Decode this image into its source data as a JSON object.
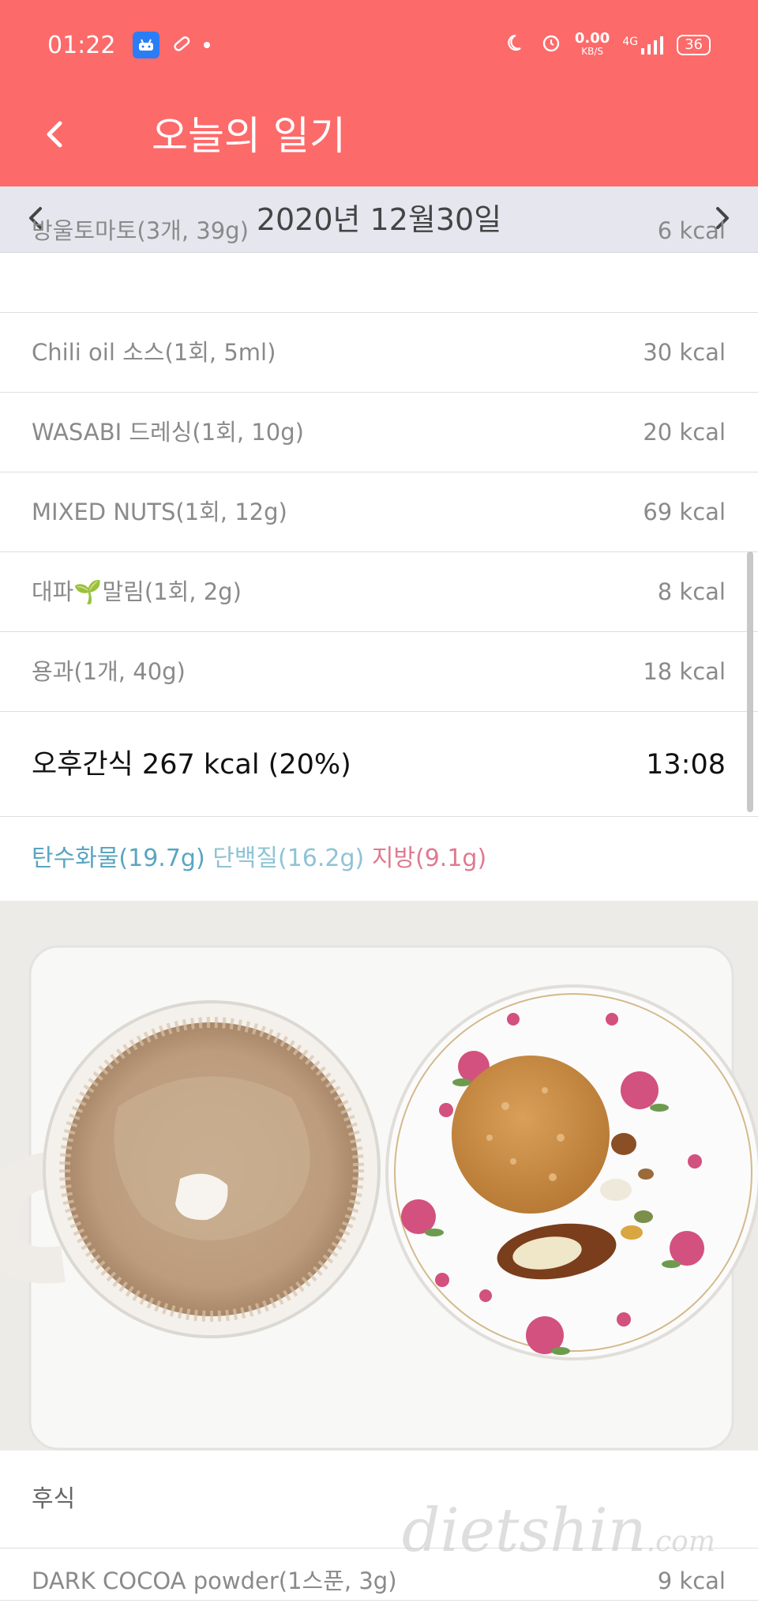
{
  "status": {
    "time": "01:22",
    "net_speed": "0.00",
    "net_unit": "KB/S",
    "network": "4G",
    "battery": "36"
  },
  "toolbar": {
    "back_icon": "back-arrow",
    "title": "오늘의 일기"
  },
  "datebar": {
    "prev_icon": "chevron-left",
    "next_icon": "chevron-right",
    "date": "2020년 12월30일"
  },
  "food_items": [
    {
      "name": "방울토마토(3개, 39g)",
      "kcal": "6 kcal"
    },
    {
      "name": "Chili oil 소스(1회, 5ml)",
      "kcal": "30 kcal"
    },
    {
      "name": "WASABI 드레싱(1회, 10g)",
      "kcal": "20 kcal"
    },
    {
      "name": "MIXED NUTS(1회, 12g)",
      "kcal": "69 kcal"
    },
    {
      "name": "대파🌱말림(1회, 2g)",
      "kcal": "8 kcal"
    },
    {
      "name": "용과(1개, 40g)",
      "kcal": "18 kcal"
    }
  ],
  "meal": {
    "title": "오후간식 267 kcal (20%)",
    "time": "13:08"
  },
  "macros": {
    "carb": "탄수화물(19.7g)",
    "protein": "단백질(16.2g)",
    "fat": "지방(9.1g)",
    "carb_color": "#5aa5c0",
    "protein_color": "#8fc3d6",
    "fat_color": "#e07a8f"
  },
  "next_section": {
    "title": "후식",
    "item_name": "DARK COCOA powder(1스푼, 3g)",
    "item_kcal": "9 kcal"
  },
  "watermark": {
    "text": "dietshin",
    "suffix": ".com"
  },
  "colors": {
    "accent": "#fd6a6a",
    "datebar_bg": "#e6e6ef"
  }
}
